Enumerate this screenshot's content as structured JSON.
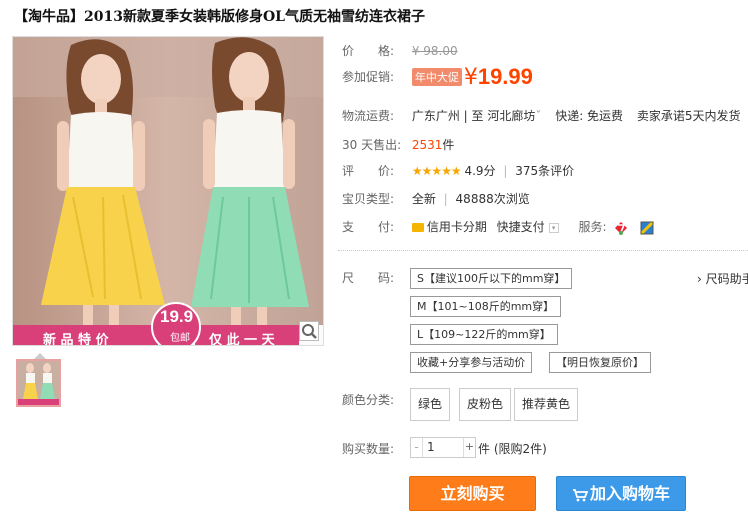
{
  "product": {
    "title": "【淘牛品】2013新款夏季女装韩版修身OL气质无袖雪纺连衣裙子"
  },
  "image": {
    "banner_left": "新 品 特 价",
    "banner_right": "仅 此 一 天",
    "badge_price": "19.9",
    "badge_sub": "包邮"
  },
  "price": {
    "label": "价　　格:",
    "original": "¥ 98.00"
  },
  "promo": {
    "label": "参加促销:",
    "badge": "年中大促",
    "currency": "¥",
    "price": "19.99"
  },
  "shipping": {
    "label": "物流运费:",
    "from": "广东广州",
    "sep": "| 至",
    "to": "河北廊坊",
    "to_arrow": "ˇ",
    "express": "快递: 免运费",
    "promise": "卖家承诺5天内发货"
  },
  "sales": {
    "label": "30 天售出:",
    "count": "2531",
    "unit": "件"
  },
  "rating": {
    "label": "评　　价:",
    "stars": "★★★★★",
    "score": "4.9分",
    "sep": "|",
    "reviews": "375条评价"
  },
  "type": {
    "label": "宝贝类型:",
    "value": "全新",
    "sep": "|",
    "views": "48888次浏览"
  },
  "payment": {
    "label": "支　　付:",
    "credit": "信用卡分期",
    "quick": "快捷支付",
    "dropdown": "▾",
    "service_label": "服务:"
  },
  "size": {
    "label": "尺　　码:",
    "guide": "› 尺码助手",
    "options": [
      "S【建议100斤以下的mm穿】",
      "M【101~108斤的mm穿】",
      "L【109~122斤的mm穿】",
      "收藏+分享参与活动价",
      "【明日恢复原价】"
    ]
  },
  "color": {
    "label": "颜色分类:",
    "options": [
      "绿色",
      "皮粉色",
      "推荐黄色"
    ]
  },
  "quantity": {
    "label": "购买数量:",
    "minus": "-",
    "value": "1",
    "plus": "+",
    "unit": "件",
    "limit": "(限购2件)"
  },
  "actions": {
    "buy_now": "立刻购买",
    "add_cart": "加入购物车",
    "cart_icon": "cart-icon"
  },
  "colors": {
    "accent": "#ff4400",
    "buy_button": "#ff7c1a",
    "cart_button": "#3c9ae8",
    "promo_badge": "#f28b6c",
    "stars": "#f7a700"
  }
}
